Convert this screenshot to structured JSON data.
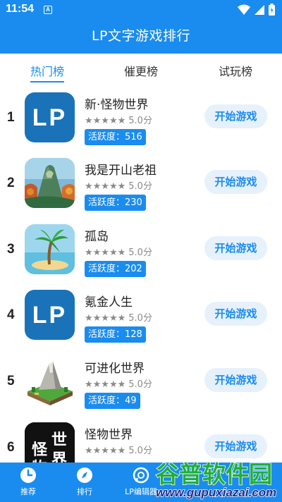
{
  "status_bar": {
    "time": "11:54",
    "notification_letter": "A"
  },
  "app_bar": {
    "title": "LP文字游戏排行"
  },
  "tabs": [
    {
      "label": "热门榜",
      "active": true
    },
    {
      "label": "催更榜",
      "active": false
    },
    {
      "label": "试玩榜",
      "active": false
    }
  ],
  "games": [
    {
      "rank": "1",
      "name": "新·怪物世界",
      "stars": "★★★★★",
      "score": "5.0分",
      "activity": "活跃度：516",
      "button": "开始游戏",
      "icon": "lp-logo-icon"
    },
    {
      "rank": "2",
      "name": "我是开山老祖",
      "stars": "★★★★★",
      "score": "5.0分",
      "activity": "活跃度：230",
      "button": "开始游戏",
      "icon": "mountain-landscape-icon"
    },
    {
      "rank": "3",
      "name": "孤岛",
      "stars": "★★★★★",
      "score": "5.0分",
      "activity": "活跃度：202",
      "button": "开始游戏",
      "icon": "palm-island-icon"
    },
    {
      "rank": "4",
      "name": "氪金人生",
      "stars": "★★★★★",
      "score": "5.0分",
      "activity": "活跃度：128",
      "button": "开始游戏",
      "icon": "lp-logo-icon"
    },
    {
      "rank": "5",
      "name": "可进化世界",
      "stars": "★★★★★",
      "score": "5.0分",
      "activity": "活跃度：49",
      "button": "开始游戏",
      "icon": "voxel-mountain-icon"
    },
    {
      "rank": "6",
      "name": "怪物世界",
      "stars": "★★★★★",
      "score": "5.0分",
      "activity": "",
      "button": "开始游戏",
      "icon": "monster-world-text-icon",
      "icon_text": "怪世物界"
    }
  ],
  "bottom_nav": [
    {
      "label": "推荐",
      "icon": "clock-icon"
    },
    {
      "label": "排行",
      "icon": "compass-icon"
    },
    {
      "label": "LP编辑器",
      "icon": "chat-bubble-icon"
    }
  ],
  "watermark": {
    "title": "谷普软件园",
    "url": "www.gupuxiazai.com"
  },
  "colors": {
    "primary": "#1a8cef",
    "button_bg": "#e6f1fc",
    "text_dark": "#222222",
    "text_gray": "#8a8a8a"
  }
}
